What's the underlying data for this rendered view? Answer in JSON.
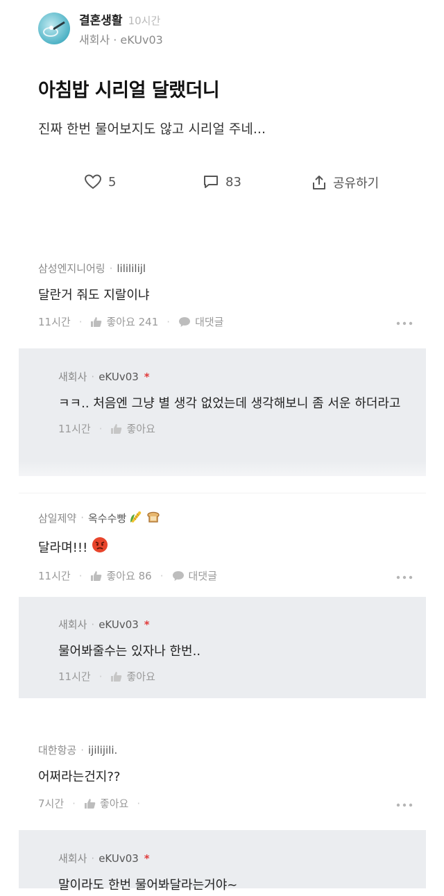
{
  "post": {
    "channel": "결혼생활",
    "time": "10시간",
    "author": "새회사 · eKUv03",
    "title": "아침밥 시리얼 달랬더니",
    "body": "진짜 한번 물어보지도 않고 시리얼 주네...",
    "likes": "5",
    "comments": "83",
    "share_label": "공유하기"
  },
  "comments": [
    {
      "company": "삼성엔지니어링",
      "nick": "lilililijl",
      "text": "달란거 줘도 지랄이냐",
      "time": "11시간",
      "likes": "좋아요 241",
      "reply_label": "대댓글",
      "reply": {
        "company": "새회사",
        "nick": "eKUv03",
        "text": "ㅋㅋ.. 처음엔 그냥 별 생각 없었는데 생각해보니 좀 서운 하더라고",
        "time": "11시간",
        "likes": "좋아요"
      }
    },
    {
      "company": "삼일제약",
      "nick": "옥수수빵",
      "text": "달라며!!!",
      "time": "11시간",
      "likes": "좋아요 86",
      "reply_label": "대댓글",
      "reply": {
        "company": "새회사",
        "nick": "eKUv03",
        "text": "물어봐줄수는 있자나 한번..",
        "time": "11시간",
        "likes": "좋아요"
      }
    },
    {
      "company": "대한항공",
      "nick": "ijilijili.",
      "text": "어쩌라는건지??",
      "time": "7시간",
      "likes": "좋아요",
      "reply": {
        "company": "새회사",
        "nick": "eKUv03",
        "text": "말이라도 한번 물어봐달라는거야~"
      }
    }
  ],
  "icons": {
    "avatar": "ring-photo",
    "like": "heart-icon",
    "comment": "speech-bubble-icon",
    "share": "share-icon",
    "thumb": "thumbs-up-icon",
    "reply": "reply-bubble-icon",
    "more": "more-dots-icon",
    "author_badge": "red-star"
  },
  "colors": {
    "reply_bg": "#ebedf0",
    "badge": "#e03c3c"
  }
}
